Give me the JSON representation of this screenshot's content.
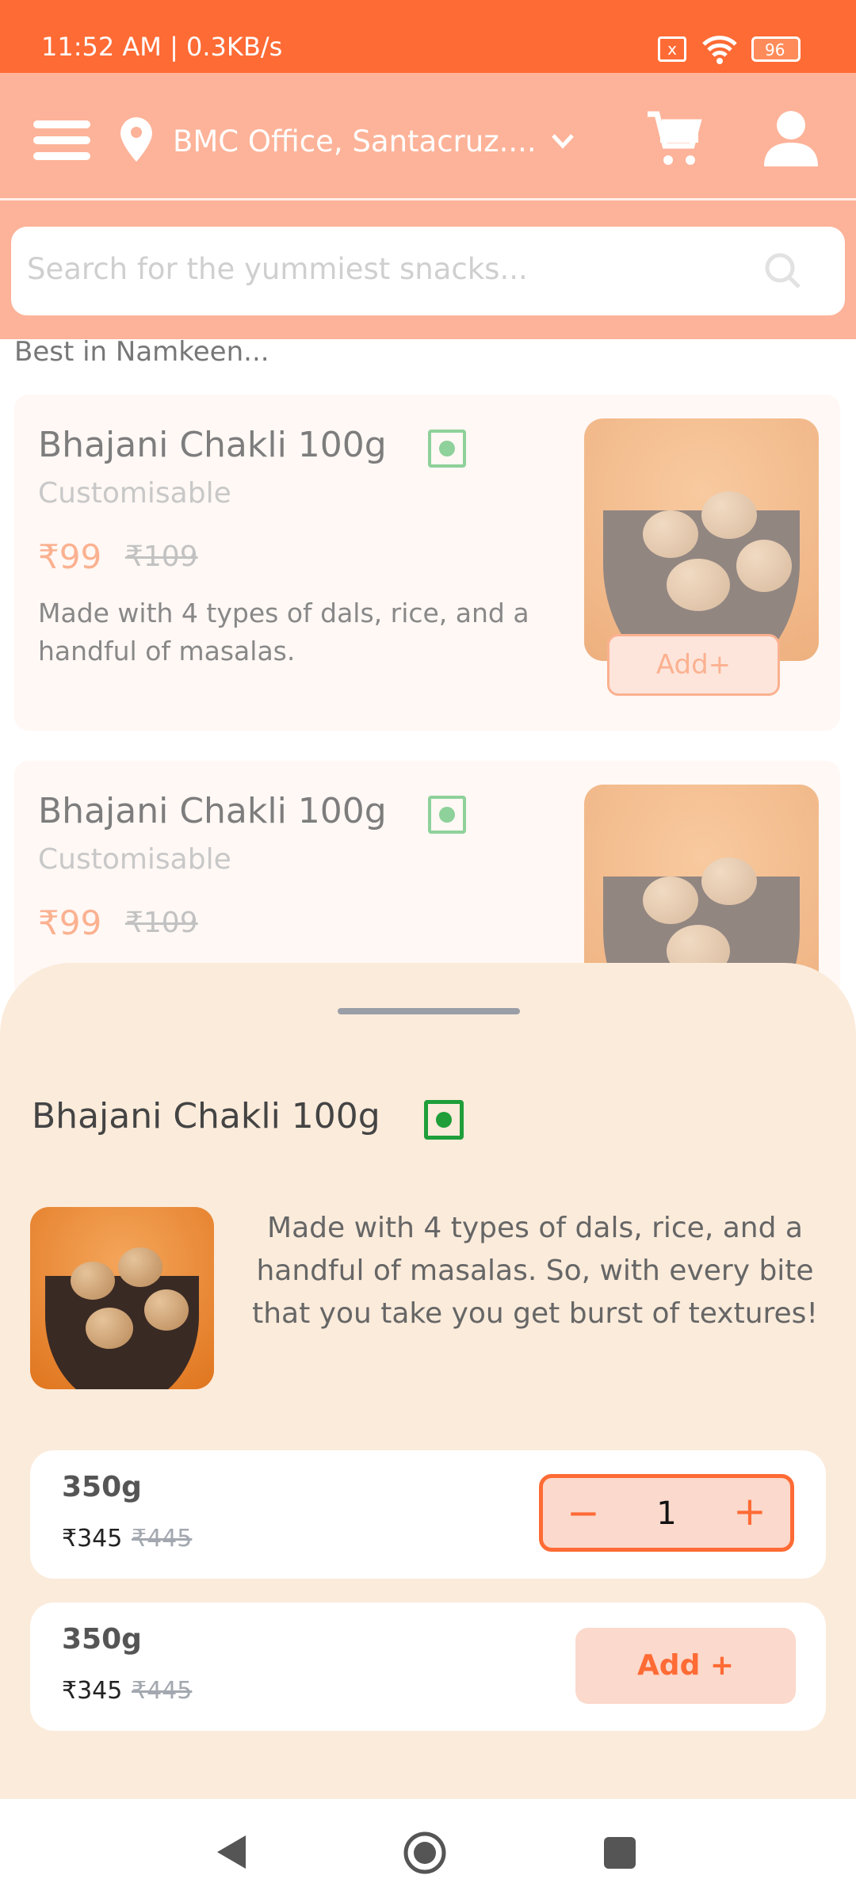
{
  "status_bar": {
    "time": "11:52 AM | 0.3KB/s",
    "battery": "96",
    "icons": [
      "sim-x-icon",
      "wifi-icon",
      "battery-icon"
    ]
  },
  "header": {
    "location": "BMC Office, Santacruz....",
    "icons": [
      "menu-icon",
      "location-pin-icon",
      "chevron-down-icon",
      "cart-icon",
      "user-icon"
    ]
  },
  "search": {
    "placeholder": "Search for the yummiest snacks..."
  },
  "section_title": "Best in Namkeen...",
  "products": [
    {
      "name": "Bhajani Chakli 100g",
      "tag": "Customisable",
      "price": "₹99",
      "mrp": "₹109",
      "description": "Made with 4 types of dals, rice, and a handful of masalas.",
      "add_label": "Add+"
    },
    {
      "name": "Bhajani Chakli 100g",
      "tag": "Customisable",
      "price": "₹99",
      "mrp": "₹109"
    }
  ],
  "sheet": {
    "title": "Bhajani Chakli 100g",
    "description": "Made with 4 types of dals, rice, and a handful of masalas. So, with every bite that you take you get burst of textures!",
    "options": [
      {
        "size": "350g",
        "price": "₹345",
        "mrp": "₹445",
        "quantity": "1"
      },
      {
        "size": "350g",
        "price": "₹345",
        "mrp": "₹445",
        "add_label": "Add +"
      }
    ]
  },
  "colors": {
    "accent": "#ff6b35",
    "header": "#fdb399",
    "sheet": "#fbebdb",
    "veg": "#1f9e3a"
  }
}
